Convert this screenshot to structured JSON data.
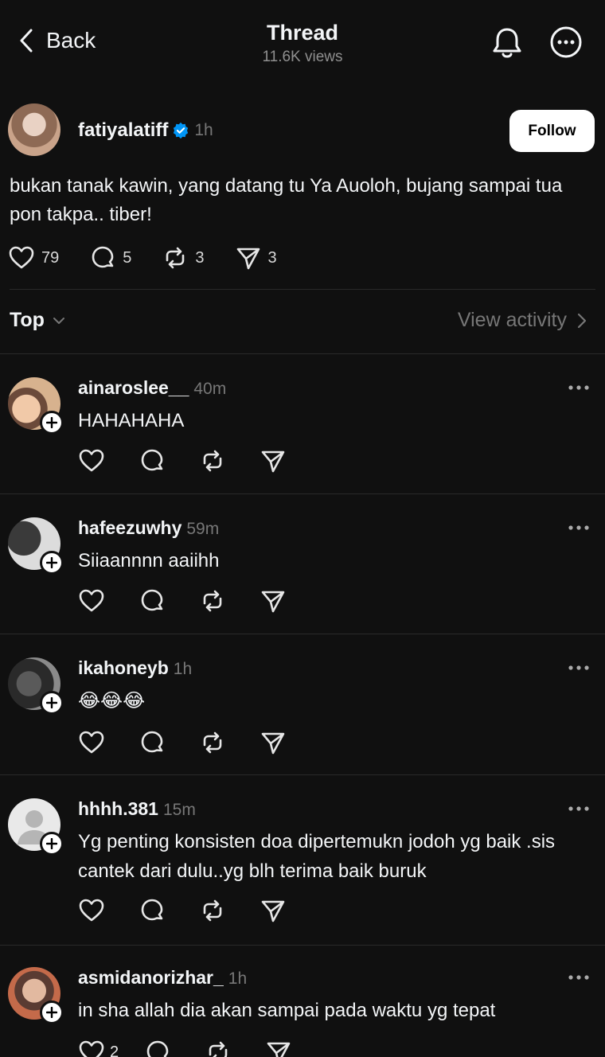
{
  "header": {
    "back_label": "Back",
    "title": "Thread",
    "views": "11.6K views"
  },
  "post": {
    "username": "fatiyalatiff",
    "verified": true,
    "time": "1h",
    "follow_label": "Follow",
    "text": "bukan tanak kawin, yang datang tu Ya Auoloh, bujang sampai tua pon takpa.. tiber!",
    "likes": "79",
    "replies": "5",
    "reposts": "3",
    "shares": "3"
  },
  "sort": {
    "label": "Top",
    "view_activity": "View activity"
  },
  "replies": [
    {
      "username": "ainaroslee__",
      "time": "40m",
      "text": "HAHAHAHA",
      "likes": ""
    },
    {
      "username": "hafeezuwhy",
      "time": "59m",
      "text": "Siiaannnn aaiihh",
      "likes": ""
    },
    {
      "username": "ikahoneyb",
      "time": "1h",
      "text": "😂😂😂",
      "likes": ""
    },
    {
      "username": "hhhh.381",
      "time": "15m",
      "text": "Yg penting konsisten doa dipertemukn jodoh yg baik .sis cantek dari dulu..yg blh terima baik buruk",
      "likes": ""
    },
    {
      "username": "asmidanorizhar_",
      "time": "1h",
      "text": "in sha allah dia akan sampai pada waktu yg tepat",
      "likes": "2"
    }
  ],
  "colors": {
    "background": "#101010",
    "text_primary": "#f3f5f7",
    "text_secondary": "#777777",
    "verified_blue": "#0095f6",
    "follow_button": "#ffffff"
  },
  "icons": [
    "chevron-left-icon",
    "bell-icon",
    "more-circle-icon",
    "verified-badge-icon",
    "heart-icon",
    "comment-icon",
    "repost-icon",
    "share-icon",
    "chevron-down-icon",
    "chevron-right-icon",
    "plus-icon",
    "more-dots-icon"
  ]
}
